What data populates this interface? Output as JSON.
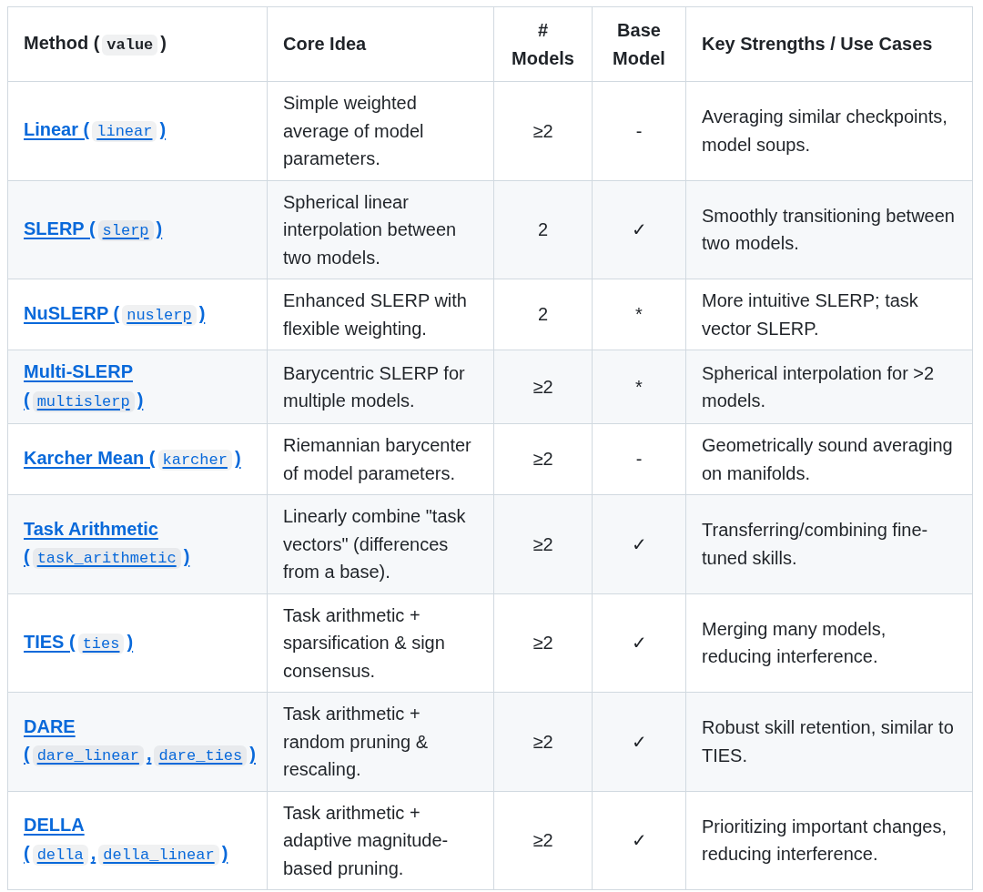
{
  "table": {
    "columns": [
      {
        "parts": [
          {
            "kind": "text",
            "text": "Method ("
          },
          {
            "kind": "code",
            "text": "value"
          },
          {
            "kind": "text",
            "text": ")"
          }
        ]
      },
      {
        "parts": [
          {
            "kind": "text",
            "text": "Core Idea"
          }
        ]
      },
      {
        "parts": [
          {
            "kind": "text",
            "text": "# Models"
          }
        ]
      },
      {
        "parts": [
          {
            "kind": "text",
            "text": "Base Model"
          }
        ]
      },
      {
        "parts": [
          {
            "kind": "text",
            "text": "Key Strengths / Use Cases"
          }
        ]
      }
    ],
    "rows": [
      {
        "method": [
          {
            "kind": "text",
            "text": "Linear ("
          },
          {
            "kind": "code",
            "text": "linear"
          },
          {
            "kind": "text",
            "text": ")"
          }
        ],
        "core_idea": "Simple weighted average of model parameters.",
        "models": "≥2",
        "base_model": "-",
        "strengths": "Averaging similar checkpoints, model soups."
      },
      {
        "method": [
          {
            "kind": "text",
            "text": "SLERP ("
          },
          {
            "kind": "code",
            "text": "slerp"
          },
          {
            "kind": "text",
            "text": ")"
          }
        ],
        "core_idea": "Spherical linear interpolation between two models.",
        "models": "2",
        "base_model": "✓",
        "strengths": "Smoothly transitioning between two models."
      },
      {
        "method": [
          {
            "kind": "text",
            "text": "NuSLERP ("
          },
          {
            "kind": "code",
            "text": "nuslerp"
          },
          {
            "kind": "text",
            "text": ")"
          }
        ],
        "core_idea": "Enhanced SLERP with flexible weighting.",
        "models": "2",
        "base_model": "*",
        "strengths": "More intuitive SLERP; task vector SLERP."
      },
      {
        "method": [
          {
            "kind": "text",
            "text": "Multi-SLERP ("
          },
          {
            "kind": "code",
            "text": "multislerp"
          },
          {
            "kind": "text",
            "text": ")"
          }
        ],
        "core_idea": "Barycentric SLERP for multiple models.",
        "models": "≥2",
        "base_model": "*",
        "strengths": "Spherical interpolation for >2 models."
      },
      {
        "method": [
          {
            "kind": "text",
            "text": "Karcher Mean ("
          },
          {
            "kind": "code",
            "text": "karcher"
          },
          {
            "kind": "text",
            "text": ")"
          }
        ],
        "core_idea": "Riemannian barycenter of model parameters.",
        "models": "≥2",
        "base_model": "-",
        "strengths": "Geometrically sound averaging on manifolds."
      },
      {
        "method": [
          {
            "kind": "text",
            "text": "Task Arithmetic ("
          },
          {
            "kind": "code",
            "text": "task_arithmetic"
          },
          {
            "kind": "text",
            "text": ")"
          }
        ],
        "core_idea": "Linearly combine \"task vectors\" (differences from a base).",
        "models": "≥2",
        "base_model": "✓",
        "strengths": "Transferring/combining fine-tuned skills."
      },
      {
        "method": [
          {
            "kind": "text",
            "text": "TIES ("
          },
          {
            "kind": "code",
            "text": "ties"
          },
          {
            "kind": "text",
            "text": ")"
          }
        ],
        "core_idea": "Task arithmetic + sparsification & sign consensus.",
        "models": "≥2",
        "base_model": "✓",
        "strengths": "Merging many models, reducing interference."
      },
      {
        "method": [
          {
            "kind": "text",
            "text": "DARE ("
          },
          {
            "kind": "code",
            "text": "dare_linear"
          },
          {
            "kind": "text",
            "text": ","
          },
          {
            "kind": "code",
            "text": "dare_ties"
          },
          {
            "kind": "text",
            "text": ")"
          }
        ],
        "core_idea": "Task arithmetic + random pruning & rescaling.",
        "models": "≥2",
        "base_model": "✓",
        "strengths": "Robust skill retention, similar to TIES."
      },
      {
        "method": [
          {
            "kind": "text",
            "text": "DELLA ("
          },
          {
            "kind": "code",
            "text": "della"
          },
          {
            "kind": "text",
            "text": ","
          },
          {
            "kind": "code",
            "text": "della_linear"
          },
          {
            "kind": "text",
            "text": ")"
          }
        ],
        "core_idea": "Task arithmetic + adaptive magnitude-based pruning.",
        "models": "≥2",
        "base_model": "✓",
        "strengths": "Prioritizing important changes, reducing interference."
      }
    ]
  }
}
